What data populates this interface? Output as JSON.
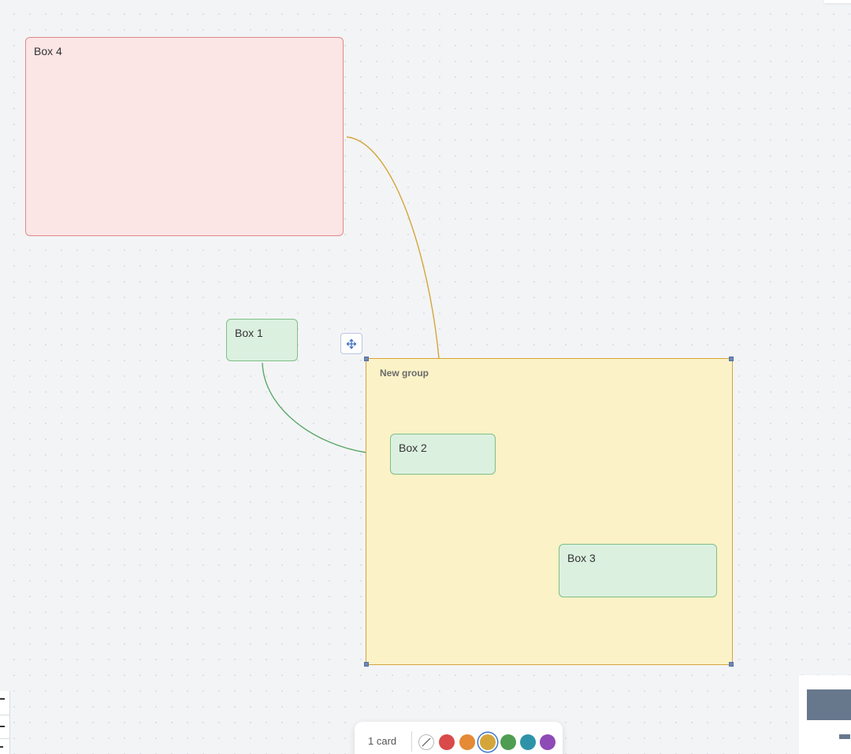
{
  "canvas": {
    "cards": [
      {
        "id": "box4",
        "label": "Box 4",
        "color": "#fce5e5"
      },
      {
        "id": "box1",
        "label": "Box 1",
        "color": "#dcf0e0"
      },
      {
        "id": "box2",
        "label": "Box 2",
        "color": "#dcf0e0"
      },
      {
        "id": "box3",
        "label": "Box 3",
        "color": "#dcf0e0"
      }
    ],
    "group": {
      "title": "New group",
      "color": "#fbf2c7"
    },
    "edges": [
      {
        "from": "Box 4",
        "to": "New group",
        "color": "#d4a63a"
      },
      {
        "from": "Box 1",
        "to": "New group",
        "color": "#5aa867"
      }
    ]
  },
  "toolbar": {
    "selection_count": "1 card",
    "swatches": [
      {
        "name": "none",
        "color": "#ffffff"
      },
      {
        "name": "red",
        "color": "#d94a4a"
      },
      {
        "name": "orange",
        "color": "#e58a35"
      },
      {
        "name": "yellow",
        "color": "#d4a63a",
        "selected": true
      },
      {
        "name": "green",
        "color": "#4f9d52"
      },
      {
        "name": "teal",
        "color": "#2e93a8"
      },
      {
        "name": "purple",
        "color": "#8e4ab5"
      }
    ]
  },
  "icons": {
    "move": "move-arrows-icon",
    "no_color": "no-color-slash-icon"
  }
}
